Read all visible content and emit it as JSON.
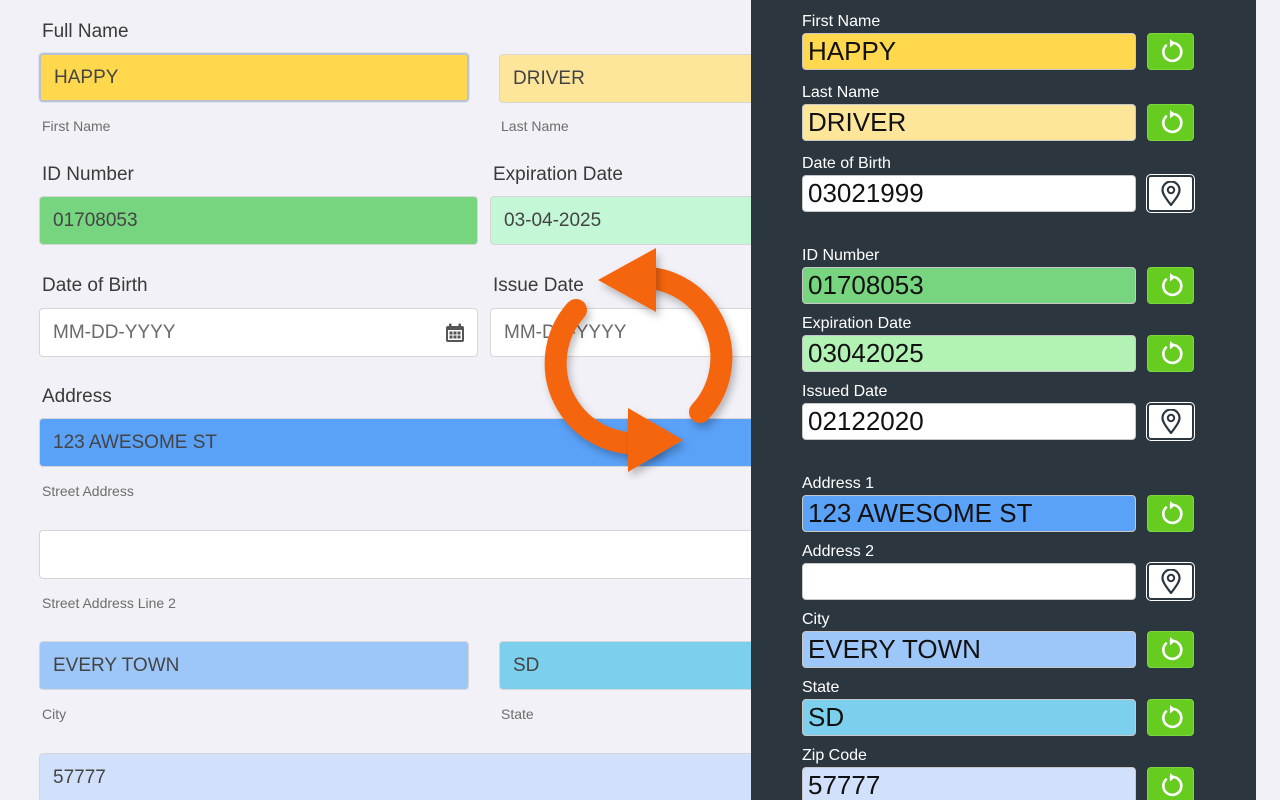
{
  "left": {
    "full_name_label": "Full Name",
    "first_name_value": "HAPPY",
    "first_name_sub": "First Name",
    "last_name_value": "DRIVER",
    "last_name_sub": "Last Name",
    "id_number_label": "ID Number",
    "id_number_value": "01708053",
    "expiration_label": "Expiration Date",
    "expiration_value": "03-04-2025",
    "dob_label": "Date of Birth",
    "dob_placeholder": "MM-DD-YYYY",
    "issue_label": "Issue Date",
    "issue_placeholder": "MM-DD-YYYY",
    "address_label": "Address",
    "street_value": "123 AWESOME ST",
    "street_sub": "Street Address",
    "street2_value": "",
    "street2_sub": "Street Address Line 2",
    "city_value": "EVERY TOWN",
    "city_sub": "City",
    "state_value": "SD",
    "state_sub": "State",
    "zip_value": "57777"
  },
  "panel": {
    "fields": [
      {
        "label": "First Name",
        "value": "HAPPY",
        "color": "#ffd84d",
        "action": "refresh-icon"
      },
      {
        "label": "Last Name",
        "value": "DRIVER",
        "color": "#fde59a",
        "action": "refresh-icon"
      },
      {
        "label": "Date of Birth",
        "value": "03021999",
        "color": "#ffffff",
        "action": "map-pin-icon"
      },
      {
        "label": "ID Number",
        "value": "01708053",
        "color": "#77d57f",
        "action": "refresh-icon"
      },
      {
        "label": "Expiration Date",
        "value": "03042025",
        "color": "#b2f2b4",
        "action": "refresh-icon"
      },
      {
        "label": "Issued Date",
        "value": "02122020",
        "color": "#ffffff",
        "action": "map-pin-icon"
      },
      {
        "label": "Address 1",
        "value": "123 AWESOME ST",
        "color": "#5aa1f8",
        "action": "refresh-icon"
      },
      {
        "label": "Address 2",
        "value": "",
        "color": "#ffffff",
        "action": "map-pin-icon"
      },
      {
        "label": "City",
        "value": "EVERY TOWN",
        "color": "#9ec7f9",
        "action": "refresh-icon"
      },
      {
        "label": "State",
        "value": "SD",
        "color": "#7dd0ed",
        "action": "refresh-icon"
      },
      {
        "label": "Zip Code",
        "value": "57777",
        "color": "#d1e0fb",
        "action": "refresh-icon"
      }
    ]
  },
  "colors": {
    "first_name": "#ffd84d",
    "last_name": "#fde59a",
    "id_number": "#77d57f",
    "expiration": "#c3f7d6",
    "street": "#5aa1f8",
    "city": "#9ec7f9",
    "state": "#7dd0ed",
    "zip": "#d1e0fb",
    "sync_arrows": "#f5650f",
    "panel_bg": "#2c363f",
    "action_green": "#66cc1f"
  },
  "sync_icon": "sync-arrows-icon"
}
